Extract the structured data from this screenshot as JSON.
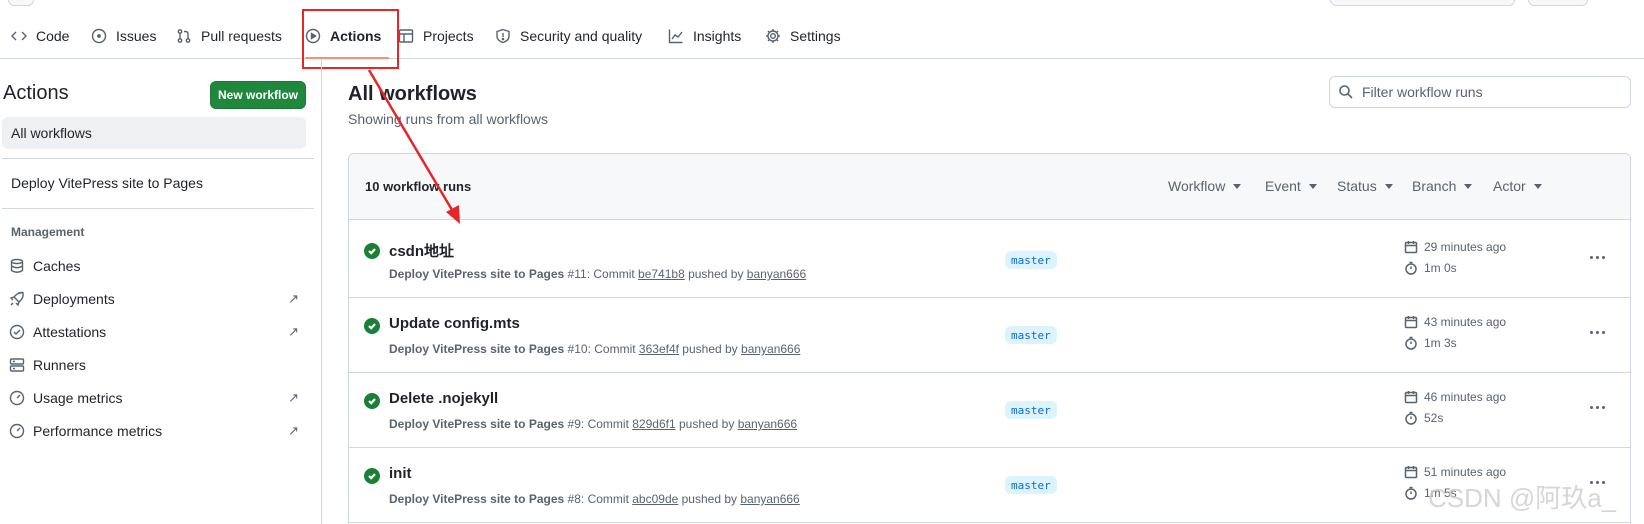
{
  "nav": {
    "tabs": [
      {
        "label": "Code",
        "icon": "code-icon"
      },
      {
        "label": "Issues",
        "icon": "issue-icon"
      },
      {
        "label": "Pull requests",
        "icon": "pull-request-icon"
      },
      {
        "label": "Actions",
        "icon": "play-icon",
        "active": true
      },
      {
        "label": "Projects",
        "icon": "table-icon"
      },
      {
        "label": "Security and quality",
        "icon": "shield-icon"
      },
      {
        "label": "Insights",
        "icon": "graph-icon"
      },
      {
        "label": "Settings",
        "icon": "gear-icon"
      }
    ]
  },
  "sidebar": {
    "title": "Actions",
    "new_workflow_label": "New workflow",
    "all_workflows_label": "All workflows",
    "workflows": [
      "Deploy VitePress site to Pages"
    ],
    "management_heading": "Management",
    "management_items": [
      {
        "label": "Caches",
        "icon": "database-icon",
        "external": false
      },
      {
        "label": "Deployments",
        "icon": "rocket-icon",
        "external": true
      },
      {
        "label": "Attestations",
        "icon": "verified-icon",
        "external": true
      },
      {
        "label": "Runners",
        "icon": "server-icon",
        "external": false
      },
      {
        "label": "Usage metrics",
        "icon": "meter-icon",
        "external": true
      },
      {
        "label": "Performance metrics",
        "icon": "meter-icon",
        "external": true
      }
    ],
    "external_glyph": "↗"
  },
  "main": {
    "title": "All workflows",
    "subtitle": "Showing runs from all workflows",
    "filter_placeholder": "Filter workflow runs",
    "runs_count": "10 workflow runs",
    "filters": [
      "Workflow",
      "Event",
      "Status",
      "Branch",
      "Actor"
    ],
    "runs": [
      {
        "title": "csdn地址",
        "workflow": "Deploy VitePress site to Pages",
        "number": "#11",
        "commit_text": ": Commit ",
        "commit": "be741b8",
        "pushed_by": " pushed by ",
        "user": "banyan666",
        "branch": "master",
        "time": "29 minutes ago",
        "duration": "1m 0s",
        "status": "success"
      },
      {
        "title": "Update config.mts",
        "workflow": "Deploy VitePress site to Pages",
        "number": "#10",
        "commit_text": ": Commit ",
        "commit": "363ef4f",
        "pushed_by": " pushed by ",
        "user": "banyan666",
        "branch": "master",
        "time": "43 minutes ago",
        "duration": "1m 3s",
        "status": "success"
      },
      {
        "title": "Delete .nojekyll",
        "workflow": "Deploy VitePress site to Pages",
        "number": "#9",
        "commit_text": ": Commit ",
        "commit": "829d6f1",
        "pushed_by": " pushed by ",
        "user": "banyan666",
        "branch": "master",
        "time": "46 minutes ago",
        "duration": "52s",
        "status": "success"
      },
      {
        "title": "init",
        "workflow": "Deploy VitePress site to Pages",
        "number": "#8",
        "commit_text": ": Commit ",
        "commit": "abc09de",
        "pushed_by": " pushed by ",
        "user": "banyan666",
        "branch": "master",
        "time": "51 minutes ago",
        "duration": "1m 5s",
        "status": "success"
      }
    ]
  },
  "annotation": {
    "color": "#e5262b"
  },
  "watermark": "CSDN @阿玖a_",
  "colors": {
    "accent_green": "#1f883d",
    "success": "#1a7f37",
    "branch_bg": "#ddf4ff",
    "branch_fg": "#0969da",
    "tab_underline": "#fd8c73"
  }
}
